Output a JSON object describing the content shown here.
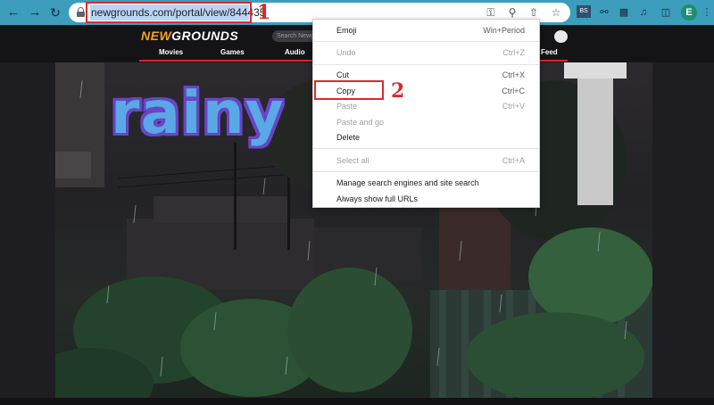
{
  "browser": {
    "url": "newgrounds.com/portal/view/844435",
    "profile_initial": "E",
    "extension_badge": "BS"
  },
  "annotations": {
    "step1": "1",
    "step2": "2"
  },
  "site": {
    "logo_new": "NEW",
    "logo_grounds": "GROUNDS",
    "search_placeholder": "Search Newgrounds",
    "nav": [
      "Movies",
      "Games",
      "Audio",
      "Feed"
    ]
  },
  "game": {
    "title": "rainy"
  },
  "context_menu": {
    "items": [
      {
        "label": "Emoji",
        "shortcut": "Win+Period",
        "enabled": true
      },
      {
        "label": "Undo",
        "shortcut": "Ctrl+Z",
        "enabled": false
      },
      {
        "label": "Cut",
        "shortcut": "Ctrl+X",
        "enabled": true
      },
      {
        "label": "Copy",
        "shortcut": "Ctrl+C",
        "enabled": true
      },
      {
        "label": "Paste",
        "shortcut": "Ctrl+V",
        "enabled": false
      },
      {
        "label": "Paste and go",
        "shortcut": "",
        "enabled": false
      },
      {
        "label": "Delete",
        "shortcut": "",
        "enabled": true
      },
      {
        "label": "Select all",
        "shortcut": "Ctrl+A",
        "enabled": false
      },
      {
        "label": "Manage search engines and site search",
        "shortcut": "",
        "enabled": true
      },
      {
        "label": "Always show full URLs",
        "shortcut": "",
        "enabled": true
      }
    ]
  },
  "colors": {
    "toolbar": "#3c9dbd",
    "annotation": "#d92b2b",
    "selection": "#bcd3f5",
    "logo_accent": "#f6a21d",
    "nav_underline": "#e0222e"
  }
}
